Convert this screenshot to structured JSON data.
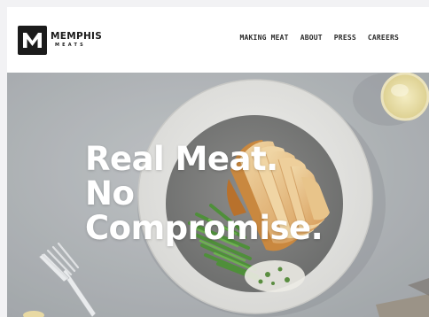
{
  "brand": {
    "logo_letter": "M",
    "name": "MEMPHIS",
    "sub": "MEATS"
  },
  "nav": {
    "items": [
      {
        "label": "MAKING MEAT"
      },
      {
        "label": "ABOUT"
      },
      {
        "label": "PRESS"
      },
      {
        "label": "CAREERS"
      }
    ]
  },
  "hero": {
    "headline_lines": [
      "Real Meat.",
      "No",
      "Compromise."
    ]
  },
  "colors": {
    "header_bg": "#ffffff",
    "logo_dark": "#1b1b1b",
    "hero_bg": "#b6b9bc",
    "headline": "#ffffff"
  }
}
